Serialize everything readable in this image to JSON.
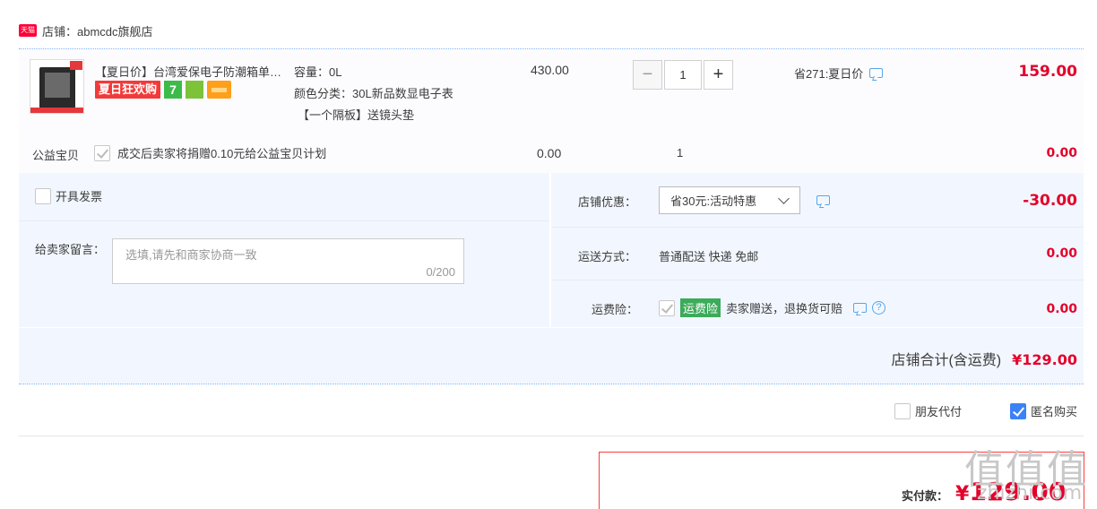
{
  "shop": {
    "badge": "天猫",
    "name": "店铺：abmcdc旗舰店"
  },
  "item": {
    "title": "【夏日价】台湾爱保电子防潮箱单反相机干燥箱",
    "tag_summer": "夏日狂欢购",
    "tag_seven": "7",
    "spec_capacity": "容量：0L",
    "spec_color": "颜色分类：30L新品数显电子表",
    "spec_gift": "【一个隔板】送镜头垫",
    "unit_price": "430.00",
    "quantity": "1",
    "qty_minus": "−",
    "qty_plus": "+",
    "discount": "省271:夏日价",
    "subtotal": "159.00"
  },
  "charity": {
    "label": "公益宝贝",
    "text": "成交后卖家将捐赠0.10元给公益宝贝计划",
    "price": "0.00",
    "quantity": "1",
    "amount": "0.00"
  },
  "invoice": {
    "label": "开具发票"
  },
  "message": {
    "label": "给卖家留言：",
    "placeholder": "选填,请先和商家协商一致",
    "counter": "0/200"
  },
  "shop_discount": {
    "label": "店铺优惠：",
    "selected": "省30元:活动特惠",
    "amount": "-30.00"
  },
  "shipping": {
    "label": "运送方式：",
    "value": "普通配送 快递 免邮",
    "amount": "0.00"
  },
  "insurance": {
    "label": "运费险：",
    "tag": "运费险",
    "text": "卖家赠送，退换货可赔",
    "amount": "0.00"
  },
  "shop_total": {
    "label": "店铺合计(含运费)",
    "amount": "¥129.00"
  },
  "options": {
    "friend_pay": "朋友代付",
    "anonymous": "匿名购买"
  },
  "payment": {
    "label": "实付款：",
    "currency": "¥",
    "amount": "129.00"
  },
  "watermark": {
    "text": "值值值",
    "sub": "zhizhi.com"
  },
  "colors": {
    "accent_red": "#e4002b",
    "panel_bg": "#f2f7ff",
    "link_blue": "#3b82f6"
  }
}
